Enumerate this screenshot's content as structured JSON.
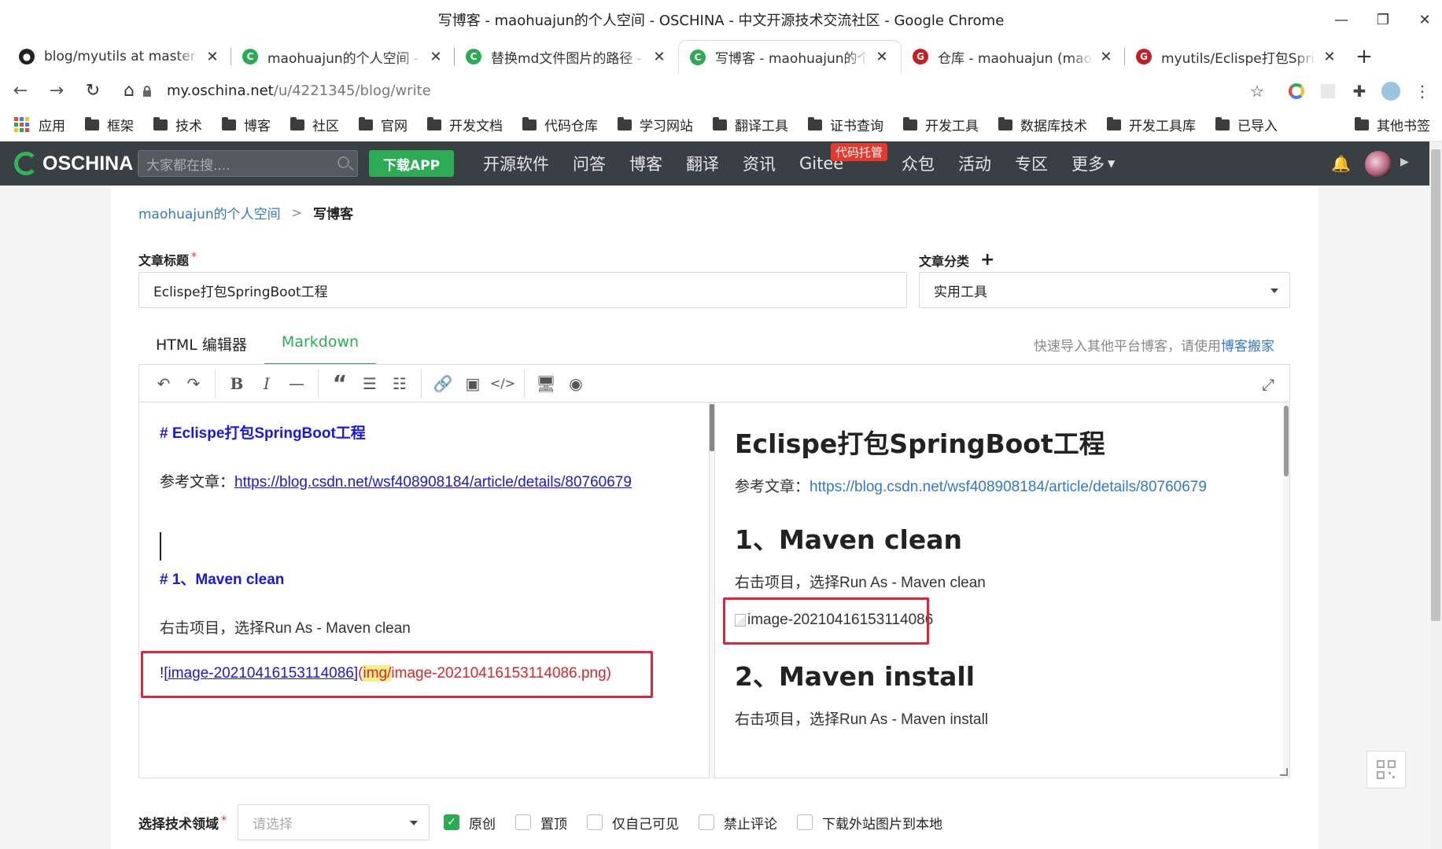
{
  "window": {
    "title": "写博客 - maohuajun的个人空间 - OSCHINA - 中文开源技术交流社区 - Google Chrome",
    "controls": [
      "minimize",
      "restore",
      "close"
    ]
  },
  "tabs": [
    {
      "label": "blog/myutils at master ·",
      "icon": "github-icon",
      "icon_color": "#222222"
    },
    {
      "label": "maohuajun的个人空间 - O",
      "icon": "oschina-icon",
      "icon_color": "#2bab53"
    },
    {
      "label": "替换md文件图片的路径 - m",
      "icon": "oschina-icon",
      "icon_color": "#2bab53"
    },
    {
      "label": "写博客 - maohuajun的个人",
      "icon": "oschina-icon",
      "icon_color": "#2bab53",
      "active": true
    },
    {
      "label": "仓库 - maohuajun (maoh",
      "icon": "gitee-icon",
      "icon_color": "#c71d23"
    },
    {
      "label": "myutils/Eclispe打包Sprin",
      "icon": "gitee-icon",
      "icon_color": "#c71d23"
    }
  ],
  "address": {
    "host": "my.oschina.net",
    "path": "/u/4221345/blog/write"
  },
  "bookmarks": {
    "apps": "应用",
    "items": [
      "框架",
      "技术",
      "博客",
      "社区",
      "官网",
      "开发文档",
      "代码仓库",
      "学习网站",
      "翻译工具",
      "证书查询",
      "开发工具",
      "数据库技术",
      "开发工具库",
      "已导入"
    ],
    "other": "其他书签"
  },
  "osc": {
    "logo": "OSCHINA",
    "search_placeholder": "大家都在搜....",
    "download_app": "下载APP",
    "nav": [
      "开源软件",
      "问答",
      "博客",
      "翻译",
      "资讯",
      "Gitee",
      "众包",
      "活动",
      "专区",
      "更多"
    ],
    "gitee_badge": "代码托管"
  },
  "breadcrumb": {
    "space": "maohuajun的个人空间",
    "sep": ">",
    "current": "写博客"
  },
  "form": {
    "title_label": "文章标题",
    "required_mark": "*",
    "title_value": "Eclispe打包SpringBoot工程",
    "category_label": "文章分类",
    "category_add": "+",
    "category_value": "实用工具",
    "tech_label": "选择技术领域",
    "tech_placeholder": "请选择"
  },
  "editor": {
    "tab_html": "HTML 编辑器",
    "tab_md": "Markdown",
    "import_hint": "快速导入其他平台博客，请使用",
    "import_link": "博客搬家",
    "markdown": {
      "h1": "# Eclispe打包SpringBoot工程",
      "ref_label": "参考文章：",
      "ref_url": "https://blog.csdn.net/wsf408908184/article/details/80760679",
      "h2": "# 1、Maven clean",
      "p1": "右击项目，选择Run As - Maven clean",
      "img_bang": "!",
      "img_alt": "[image-20210416153114086]",
      "img_open": "(",
      "img_dir": "img/",
      "img_file": "image-20210416153114086.png)"
    },
    "preview": {
      "h1": "Eclispe打包SpringBoot工程",
      "ref_label": "参考文章：",
      "ref_url": "https://blog.csdn.net/wsf408908184/article/details/80760679",
      "h2a": "1、Maven clean",
      "p1": "右击项目，选择Run As - Maven clean",
      "img_alt": "image-20210416153114086",
      "h2b": "2、Maven install",
      "p2": "右击项目，选择Run As - Maven install"
    }
  },
  "options": [
    {
      "label": "原创",
      "checked": true
    },
    {
      "label": "置顶",
      "checked": false
    },
    {
      "label": "仅自己可见",
      "checked": false
    },
    {
      "label": "禁止评论",
      "checked": false
    },
    {
      "label": "下载外站图片到本地",
      "checked": false
    }
  ]
}
